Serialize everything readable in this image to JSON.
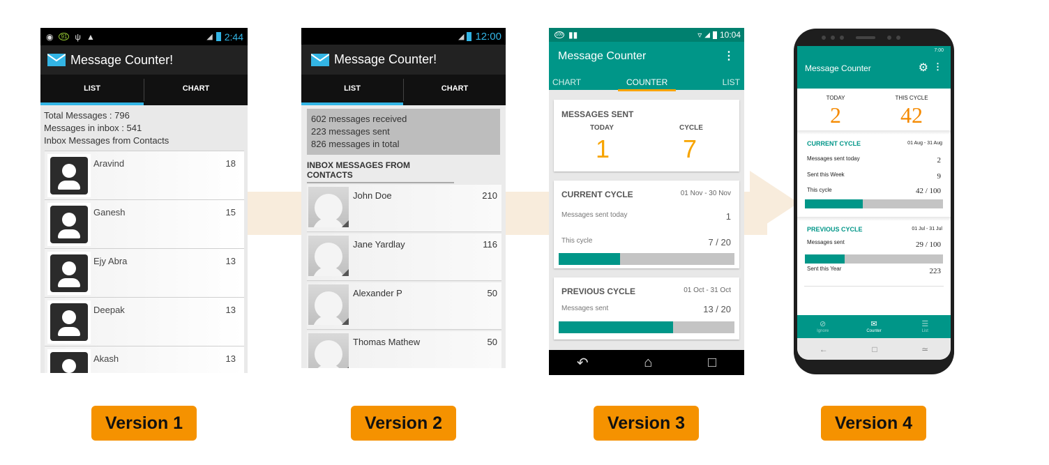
{
  "versions": [
    {
      "label": "Version 1"
    },
    {
      "label": "Version 2"
    },
    {
      "label": "Version 3"
    },
    {
      "label": "Version 4"
    }
  ],
  "v1": {
    "status_time": "2:44",
    "status_icons": [
      "sync-icon",
      "count-badge-icon",
      "usb-icon",
      "android-icon"
    ],
    "badge": "91",
    "app_title": "Message Counter!",
    "tabs": [
      "LIST",
      "CHART"
    ],
    "selected_tab": "LIST",
    "summary": [
      "Total Messages : 796",
      "Messages in inbox : 541",
      "Inbox Messages from Contacts"
    ],
    "contacts": [
      {
        "name": "Aravind",
        "count": "18"
      },
      {
        "name": "Ganesh",
        "count": "15"
      },
      {
        "name": "Ejy Abra",
        "count": "13"
      },
      {
        "name": "Deepak",
        "count": "13"
      },
      {
        "name": "Akash",
        "count": "13"
      }
    ]
  },
  "v2": {
    "status_time": "12:00",
    "app_title": "Message Counter!",
    "tabs": [
      "LIST",
      "CHART"
    ],
    "selected_tab": "LIST",
    "summary": [
      "602 messages received",
      "223 messages sent",
      "826 messages in total"
    ],
    "section_title": "INBOX MESSAGES FROM CONTACTS",
    "contacts": [
      {
        "name": "John Doe",
        "count": "210"
      },
      {
        "name": "Jane Yardlay",
        "count": "116"
      },
      {
        "name": "Alexander P",
        "count": "50"
      },
      {
        "name": "Thomas Mathew",
        "count": "50"
      }
    ]
  },
  "v3": {
    "status_badge": "100",
    "status_time": "10:04",
    "app_title": "Message Counter",
    "tabs": [
      "CHART",
      "COUNTER",
      "LIST"
    ],
    "selected_tab": "COUNTER",
    "messages_sent": {
      "title": "MESSAGES SENT",
      "today_label": "TODAY",
      "today_value": "1",
      "cycle_label": "CYCLE",
      "cycle_value": "7"
    },
    "current_cycle": {
      "title": "CURRENT CYCLE",
      "range": "01 Nov - 30 Nov",
      "today_label": "Messages sent today",
      "today_value": "1",
      "cycle_label": "This cycle",
      "cycle_value": "7 / 20",
      "progress": 0.35
    },
    "previous_cycle": {
      "title": "PREVIOUS CYCLE",
      "range": "01 Oct - 31 Oct",
      "sent_label": "Messages sent",
      "sent_value": "13 / 20",
      "progress": 0.65
    },
    "nav_icons": [
      "back-icon",
      "home-icon",
      "recents-icon"
    ]
  },
  "v4": {
    "status_time": "7:00",
    "app_title": "Message Counter",
    "today_label": "TODAY",
    "today_value": "2",
    "cycle_label": "THIS CYCLE",
    "cycle_value": "42",
    "current_cycle": {
      "title": "CURRENT CYCLE",
      "range": "01 Aug - 31 Aug",
      "today_label": "Messages sent today",
      "today_value": "2",
      "week_label": "Sent this Week",
      "week_value": "9",
      "cycle_label": "This cycle",
      "cycle_value": "42 / 100",
      "progress": 0.42
    },
    "previous_cycle": {
      "title": "PREVIOUS CYCLE",
      "range": "01 Jul - 31 Jul",
      "sent_label": "Messages sent",
      "sent_value": "29 / 100",
      "progress": 0.29,
      "year_label": "Sent this Year",
      "year_value": "223"
    },
    "bottom_nav": [
      {
        "label": "Ignore",
        "icon": "block-icon"
      },
      {
        "label": "Counter",
        "icon": "mail-icon"
      },
      {
        "label": "List",
        "icon": "list-icon"
      }
    ],
    "selected_nav": "Counter"
  },
  "colors": {
    "teal": "#009688",
    "orange": "#f7a400",
    "label_bg": "#f59200",
    "holo_blue": "#33b5e5",
    "band": "#f8ecdc"
  }
}
